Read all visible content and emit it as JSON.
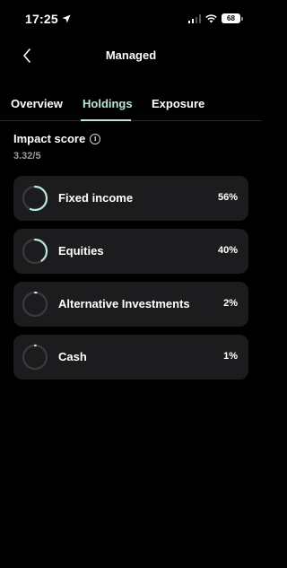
{
  "status_bar": {
    "time": "17:25",
    "battery": "68"
  },
  "header": {
    "title": "Managed"
  },
  "tabs": [
    {
      "label": "Overview",
      "active": false
    },
    {
      "label": "Holdings",
      "active": true
    },
    {
      "label": "Exposure",
      "active": false
    }
  ],
  "impact": {
    "label": "Impact score",
    "value": "3.32/5"
  },
  "holdings": [
    {
      "name": "Fixed income",
      "percent": "56%",
      "fraction": 0.56
    },
    {
      "name": "Equities",
      "percent": "40%",
      "fraction": 0.4
    },
    {
      "name": "Alternative Investments",
      "percent": "2%",
      "fraction": 0.02
    },
    {
      "name": "Cash",
      "percent": "1%",
      "fraction": 0.01
    }
  ],
  "colors": {
    "accent": "#b8e6d8",
    "card_bg": "#1c1c1e",
    "ring_track": "#3a3a3c"
  }
}
